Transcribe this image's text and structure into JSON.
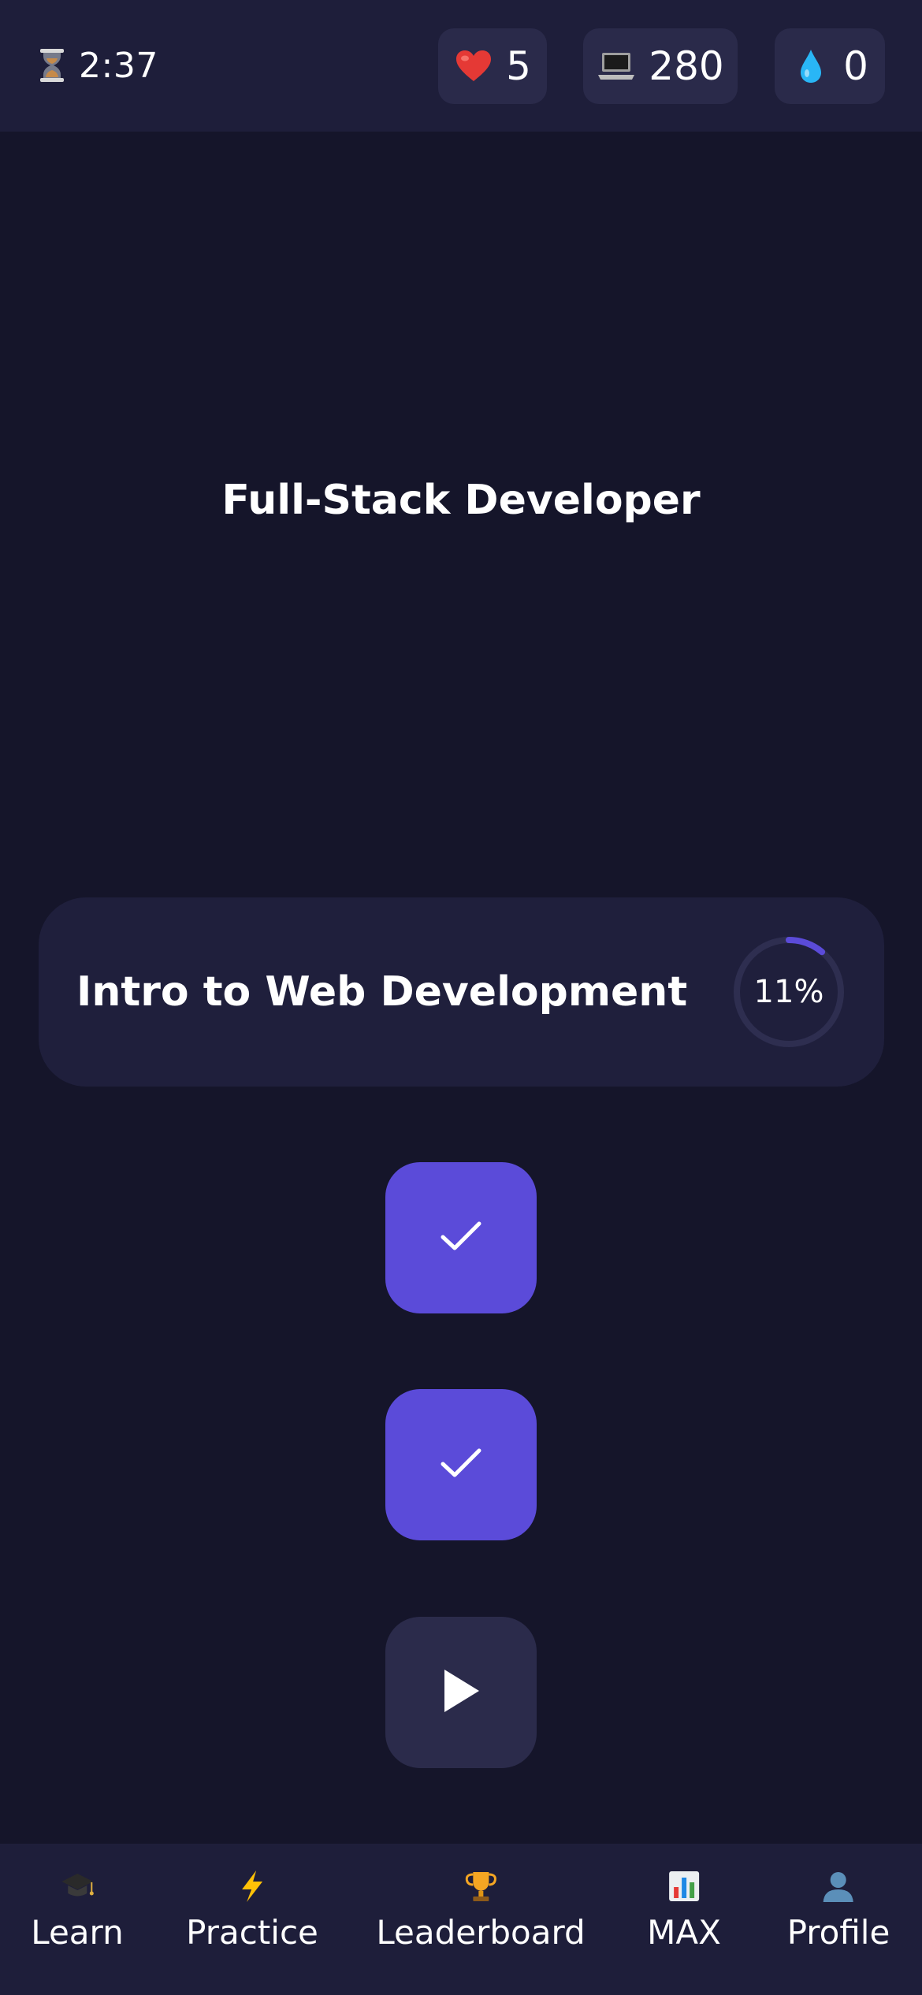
{
  "header": {
    "timer": "2:37",
    "hearts": "5",
    "gems": "280",
    "drops": "0"
  },
  "path": {
    "title": "Full-Stack Developer"
  },
  "unit": {
    "title": "Intro to Web Development",
    "progress_label": "11%",
    "progress_fraction": 0.11
  },
  "lessons": [
    {
      "state": "completed",
      "icon": "check-icon"
    },
    {
      "state": "completed",
      "icon": "check-icon"
    },
    {
      "state": "current",
      "icon": "play-icon"
    }
  ],
  "nav": {
    "items": [
      {
        "label": "Learn",
        "icon": "graduation-cap-icon"
      },
      {
        "label": "Practice",
        "icon": "lightning-icon"
      },
      {
        "label": "Leaderboard",
        "icon": "trophy-icon"
      },
      {
        "label": "MAX",
        "icon": "bar-chart-icon"
      },
      {
        "label": "Profile",
        "icon": "person-icon"
      }
    ]
  },
  "colors": {
    "background": "#15152a",
    "bar": "#1e1e3a",
    "accent": "#5b4bd9",
    "heart": "#e53935",
    "drop": "#29b6f6"
  }
}
